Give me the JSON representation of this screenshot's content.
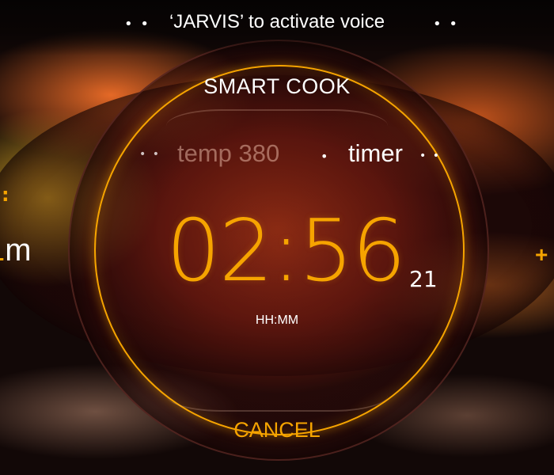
{
  "voice_hint": "‘JARVIS’ to activate voice",
  "title": "SMART COOK",
  "options": {
    "temp": "temp 380",
    "timer": "timer"
  },
  "timer": {
    "time": "02:56",
    "seconds": "21",
    "format": "HH:MM"
  },
  "side": {
    "left_partial_prefix": "1",
    "left_partial_unit": "m",
    "right_button": "+"
  },
  "cancel_label": "CANCEL",
  "colors": {
    "accent": "#f6a400",
    "text": "#ffffff",
    "inactive_option": "#d8b0a0"
  },
  "icons": {
    "page_dots": "dot-indicator-icon",
    "increase": "plus-icon"
  }
}
